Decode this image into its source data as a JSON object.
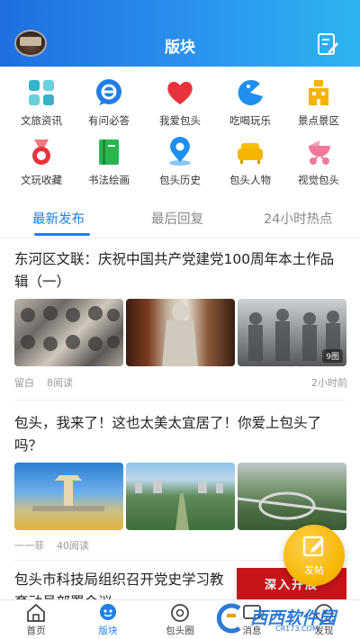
{
  "header": {
    "title": "版块"
  },
  "categories": [
    {
      "label": "文旅资讯",
      "icon": "grid-apps-icon",
      "color": "#2fb5c9"
    },
    {
      "label": "有问必答",
      "icon": "chat-e-icon",
      "color": "#1f7fe6"
    },
    {
      "label": "我爱包头",
      "icon": "heart-icon",
      "color": "#e8323e"
    },
    {
      "label": "吃喝玩乐",
      "icon": "pacman-icon",
      "color": "#1f8ff0"
    },
    {
      "label": "景点景区",
      "icon": "building-icon",
      "color": "#f5b400"
    },
    {
      "label": "文玩收藏",
      "icon": "medal-icon",
      "color": "#e8323e"
    },
    {
      "label": "书法绘画",
      "icon": "book-icon",
      "color": "#2ab54f"
    },
    {
      "label": "包头历史",
      "icon": "location-pin-icon",
      "color": "#1f8ff0"
    },
    {
      "label": "包头人物",
      "icon": "sofa-icon",
      "color": "#f5b400"
    },
    {
      "label": "视觉包头",
      "icon": "stroller-icon",
      "color": "#f07a9a"
    }
  ],
  "tabs": [
    {
      "label": "最新发布",
      "active": true
    },
    {
      "label": "最后回复",
      "active": false
    },
    {
      "label": "24小时热点",
      "active": false
    }
  ],
  "posts": [
    {
      "title": "东河区文联：庆祝中国共产党建党100周年本土作品辑（一）",
      "author": "留白",
      "reads": "8阅读",
      "time": "2小时前",
      "badge": "9图"
    },
    {
      "title": "包头，我来了！这也太美太宜居了！你爱上包头了吗？",
      "author": "一一菲",
      "reads": "40阅读",
      "time": ""
    },
    {
      "title": "包头市科技局组织召开党史学习教育动员部署会议",
      "banner": "深入开展"
    }
  ],
  "fab": {
    "label": "发帖"
  },
  "bottom_nav": [
    {
      "label": "首页",
      "icon": "home-icon",
      "active": false
    },
    {
      "label": "版块",
      "icon": "forum-icon",
      "active": true
    },
    {
      "label": "包头圈",
      "icon": "circle-icon",
      "active": false
    },
    {
      "label": "消息",
      "icon": "message-icon",
      "active": false
    },
    {
      "label": "发现",
      "icon": "discover-icon",
      "active": false
    }
  ],
  "watermark": {
    "name": "西西软件园",
    "url": "CR173.COM"
  }
}
